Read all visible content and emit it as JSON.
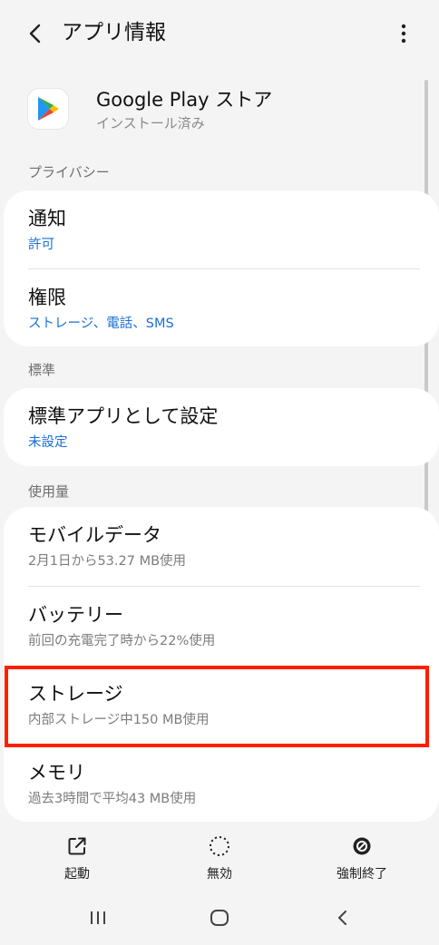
{
  "header": {
    "back_icon": "chevron-left-icon",
    "title": "アプリ情報",
    "more_icon": "more-vert-icon"
  },
  "app": {
    "name": "Google Play ストア",
    "status": "インストール済み",
    "icon": "google-play-icon"
  },
  "sections": {
    "privacy": "プライバシー",
    "defaults": "標準",
    "usage": "使用量"
  },
  "items": {
    "notifications": {
      "title": "通知",
      "sub": "許可"
    },
    "permissions": {
      "title": "権限",
      "sub": "ストレージ、電話、SMS"
    },
    "default_app": {
      "title": "標準アプリとして設定",
      "sub": "未設定"
    },
    "mobile_data": {
      "title": "モバイルデータ",
      "sub": "2月1日から53.27 MB使用"
    },
    "battery": {
      "title": "バッテリー",
      "sub": "前回の充電完了時から22%使用"
    },
    "storage": {
      "title": "ストレージ",
      "sub": "内部ストレージ中150 MB使用"
    },
    "memory": {
      "title": "メモリ",
      "sub": "過去3時間で平均43 MB使用"
    }
  },
  "actions": {
    "open": {
      "label": "起動",
      "icon": "open-external-icon"
    },
    "disable": {
      "label": "無効",
      "icon": "disable-circle-icon"
    },
    "force_stop": {
      "label": "強制終了",
      "icon": "force-stop-icon"
    }
  },
  "colors": {
    "accent_blue": "#1b6fd8",
    "highlight_red": "#ff1f00",
    "background": "#f4f4f4"
  }
}
